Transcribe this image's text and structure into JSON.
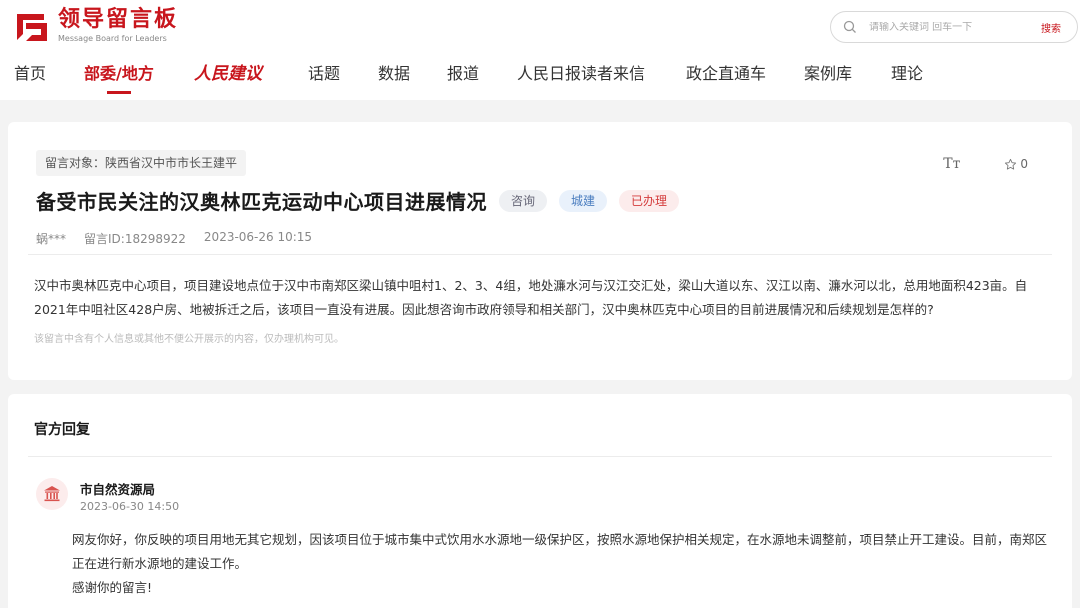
{
  "header": {
    "logo_title": "领导留言板",
    "logo_sub": "Message Board for Leaders",
    "search_placeholder": "请输入关键词 回车一下",
    "search_button": "搜索"
  },
  "nav": {
    "items": [
      {
        "label": "首页"
      },
      {
        "label": "部委/地方"
      },
      {
        "label": "人民建议"
      },
      {
        "label": "话题"
      },
      {
        "label": "数据"
      },
      {
        "label": "报道"
      },
      {
        "label": "人民日报读者来信"
      },
      {
        "label": "政企直通车"
      },
      {
        "label": "案例库"
      },
      {
        "label": "理论"
      }
    ]
  },
  "message": {
    "target": "留言对象：陕西省汉中市市长王建平",
    "font_tool": "Tт",
    "favorite_count": "0",
    "title": "备受市民关注的汉奥林匹克运动中心项目进展情况",
    "badges": [
      "咨询",
      "城建",
      "已办理"
    ],
    "author": "蜗***",
    "message_id": "留言ID:18298922",
    "time": "2023-06-26 10:15",
    "body": "汉中市奥林匹克中心项目，项目建设地点位于汉中市南郑区梁山镇中咀村1、2、3、4组，地处濂水河与汉江交汇处，梁山大道以东、汉江以南、濂水河以北，总用地面积423亩。自2021年中咀社区428户房、地被拆迁之后，该项目一直没有进展。因此想咨询市政府领导和相关部门，汉中奥林匹克中心项目的目前进展情况和后续规划是怎样的?",
    "note": "该留言中含有个人信息或其他不便公开展示的内容，仅办理机构可见。"
  },
  "reply": {
    "heading": "官方回复",
    "org": "市自然资源局",
    "time": "2023-06-30 14:50",
    "body": "网友你好，你反映的项目用地无其它规划，因该项目位于城市集中式饮用水水源地一级保护区，按照水源地保护相关规定，在水源地未调整前，项目禁止开工建设。目前，南郑区正在进行新水源地的建设工作。",
    "thanks": "感谢你的留言!"
  },
  "colors": {
    "brand_red": "#c8161d"
  }
}
